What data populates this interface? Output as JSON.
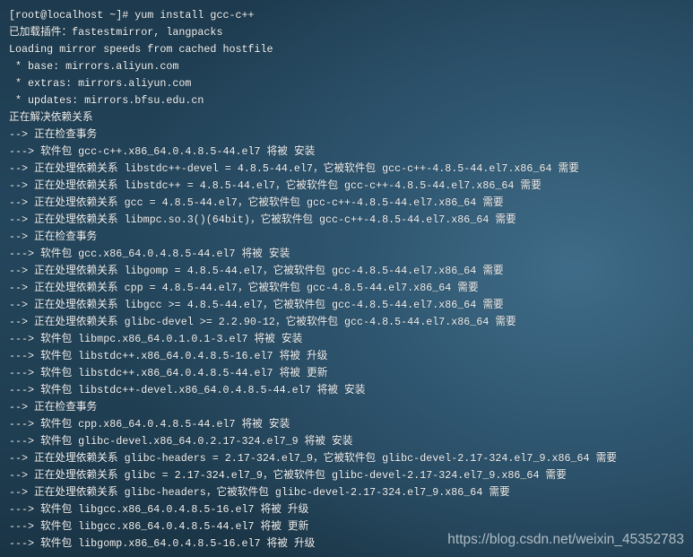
{
  "terminal": {
    "lines": [
      "[root@localhost ~]# yum install gcc-c++",
      "已加载插件：fastestmirror, langpacks",
      "Loading mirror speeds from cached hostfile",
      " * base: mirrors.aliyun.com",
      " * extras: mirrors.aliyun.com",
      " * updates: mirrors.bfsu.edu.cn",
      "正在解决依赖关系",
      "--> 正在检查事务",
      "---> 软件包 gcc-c++.x86_64.0.4.8.5-44.el7 将被 安装",
      "--> 正在处理依赖关系 libstdc++-devel = 4.8.5-44.el7，它被软件包 gcc-c++-4.8.5-44.el7.x86_64 需要",
      "--> 正在处理依赖关系 libstdc++ = 4.8.5-44.el7，它被软件包 gcc-c++-4.8.5-44.el7.x86_64 需要",
      "--> 正在处理依赖关系 gcc = 4.8.5-44.el7，它被软件包 gcc-c++-4.8.5-44.el7.x86_64 需要",
      "--> 正在处理依赖关系 libmpc.so.3()(64bit)，它被软件包 gcc-c++-4.8.5-44.el7.x86_64 需要",
      "--> 正在检查事务",
      "---> 软件包 gcc.x86_64.0.4.8.5-44.el7 将被 安装",
      "--> 正在处理依赖关系 libgomp = 4.8.5-44.el7，它被软件包 gcc-4.8.5-44.el7.x86_64 需要",
      "--> 正在处理依赖关系 cpp = 4.8.5-44.el7，它被软件包 gcc-4.8.5-44.el7.x86_64 需要",
      "--> 正在处理依赖关系 libgcc >= 4.8.5-44.el7，它被软件包 gcc-4.8.5-44.el7.x86_64 需要",
      "--> 正在处理依赖关系 glibc-devel >= 2.2.90-12，它被软件包 gcc-4.8.5-44.el7.x86_64 需要",
      "---> 软件包 libmpc.x86_64.0.1.0.1-3.el7 将被 安装",
      "---> 软件包 libstdc++.x86_64.0.4.8.5-16.el7 将被 升级",
      "---> 软件包 libstdc++.x86_64.0.4.8.5-44.el7 将被 更新",
      "---> 软件包 libstdc++-devel.x86_64.0.4.8.5-44.el7 将被 安装",
      "--> 正在检查事务",
      "---> 软件包 cpp.x86_64.0.4.8.5-44.el7 将被 安装",
      "---> 软件包 glibc-devel.x86_64.0.2.17-324.el7_9 将被 安装",
      "--> 正在处理依赖关系 glibc-headers = 2.17-324.el7_9，它被软件包 glibc-devel-2.17-324.el7_9.x86_64 需要",
      "--> 正在处理依赖关系 glibc = 2.17-324.el7_9，它被软件包 glibc-devel-2.17-324.el7_9.x86_64 需要",
      "--> 正在处理依赖关系 glibc-headers，它被软件包 glibc-devel-2.17-324.el7_9.x86_64 需要",
      "---> 软件包 libgcc.x86_64.0.4.8.5-16.el7 将被 升级",
      "---> 软件包 libgcc.x86_64.0.4.8.5-44.el7 将被 更新",
      "---> 软件包 libgomp.x86_64.0.4.8.5-16.el7 将被 升级"
    ]
  },
  "watermark": "https://blog.csdn.net/weixin_45352783"
}
